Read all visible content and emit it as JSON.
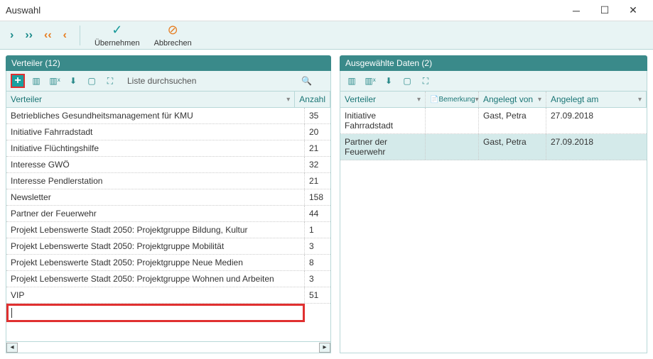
{
  "window": {
    "title": "Auswahl"
  },
  "toolbar": {
    "apply": "Übernehmen",
    "cancel": "Abbrechen"
  },
  "left_panel": {
    "title": "Verteiler (12)",
    "search_placeholder": "Liste durchsuchen",
    "columns": {
      "verteiler": "Verteiler",
      "anzahl": "Anzahl"
    },
    "rows": [
      {
        "name": "Betriebliches Gesundheitsmanagement für KMU",
        "count": "35"
      },
      {
        "name": "Initiative Fahrradstadt",
        "count": "20"
      },
      {
        "name": "Initiative Flüchtingshilfe",
        "count": "21"
      },
      {
        "name": "Interesse GWÖ",
        "count": "32"
      },
      {
        "name": "Interesse Pendlerstation",
        "count": "21"
      },
      {
        "name": "Newsletter",
        "count": "158"
      },
      {
        "name": "Partner der Feuerwehr",
        "count": "44"
      },
      {
        "name": "Projekt Lebenswerte Stadt 2050: Projektgruppe Bildung, Kultur",
        "count": "1"
      },
      {
        "name": "Projekt Lebenswerte Stadt 2050: Projektgruppe Mobilität",
        "count": "3"
      },
      {
        "name": "Projekt Lebenswerte Stadt 2050: Projektgruppe Neue Medien",
        "count": "8"
      },
      {
        "name": "Projekt Lebenswerte Stadt 2050: Projektgruppe Wohnen und Arbeiten",
        "count": "3"
      },
      {
        "name": "VIP",
        "count": "51"
      }
    ]
  },
  "right_panel": {
    "title": "Ausgewählte Daten (2)",
    "columns": {
      "verteiler": "Verteiler",
      "bemerkung": "Bemerkung",
      "angelegt_von": "Angelegt von",
      "angelegt_am": "Angelegt am"
    },
    "rows": [
      {
        "verteiler": "Initiative Fahrradstadt",
        "bemerkung": "",
        "angelegt_von": "Gast, Petra",
        "angelegt_am": "27.09.2018"
      },
      {
        "verteiler": "Partner der Feuerwehr",
        "bemerkung": "",
        "angelegt_von": "Gast, Petra",
        "angelegt_am": "27.09.2018"
      }
    ]
  }
}
